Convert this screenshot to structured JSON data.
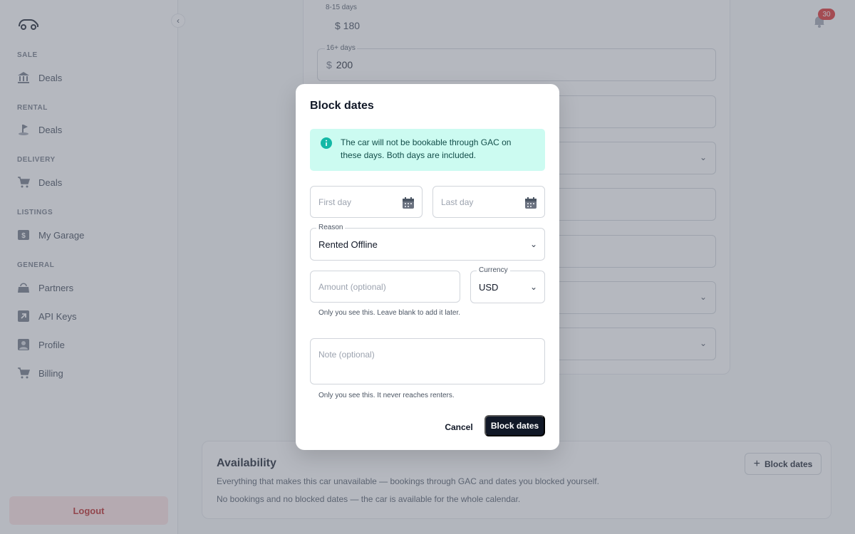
{
  "sidebar": {
    "logo": "car-logo",
    "collapse_icon": "‹",
    "sections": [
      {
        "label": "SALE",
        "items": [
          {
            "label": "Deals",
            "icon": "bank-icon"
          }
        ]
      },
      {
        "label": "RENTAL",
        "items": [
          {
            "label": "Deals",
            "icon": "golf-flag-icon"
          }
        ]
      },
      {
        "label": "DELIVERY",
        "items": [
          {
            "label": "Deals",
            "icon": "cart-icon"
          }
        ]
      },
      {
        "label": "LISTINGS",
        "items": [
          {
            "label": "My Garage",
            "icon": "dollar-tag-icon"
          }
        ]
      },
      {
        "label": "GENERAL",
        "items": [
          {
            "label": "Partners",
            "icon": "bag-icon"
          },
          {
            "label": "API Keys",
            "icon": "arrow-up-right-icon"
          },
          {
            "label": "Profile",
            "icon": "user-icon"
          },
          {
            "label": "Billing",
            "icon": "cart-icon"
          }
        ]
      }
    ],
    "logout_label": "Logout"
  },
  "header": {
    "notification_count": "30"
  },
  "background_form": {
    "prev_label": "8-15 days",
    "prev_value": "$ 180",
    "field_16_label": "16+ days",
    "field_16_currency": "$",
    "field_16_value": "200"
  },
  "availability": {
    "title": "Availability",
    "description": "Everything that makes this car unavailable — bookings through GAC and dates you blocked yourself.",
    "empty_text": "No bookings and no blocked dates — the car is available for the whole calendar.",
    "block_button_label": "Block dates",
    "block_button_icon": "+"
  },
  "modal": {
    "title": "Block dates",
    "info_text": "The car will not be bookable through GAC on these days. Both days are included.",
    "first_day_placeholder": "First day",
    "last_day_placeholder": "Last day",
    "reason_label": "Reason",
    "reason_value": "Rented Offline",
    "amount_placeholder": "Amount (optional)",
    "currency_label": "Currency",
    "currency_value": "USD",
    "amount_help": "Only you see this. Leave blank to add it later.",
    "note_placeholder": "Note (optional)",
    "note_help": "Only you see this. It never reaches renters.",
    "cancel_label": "Cancel",
    "submit_label": "Block dates"
  },
  "colors": {
    "accent_dark": "#111827",
    "info_bg": "#ccfbf1",
    "info_icon": "#14b8a6",
    "logout_bg": "#fee2e2",
    "logout_text": "#b91c1c",
    "badge": "#dc2626"
  }
}
